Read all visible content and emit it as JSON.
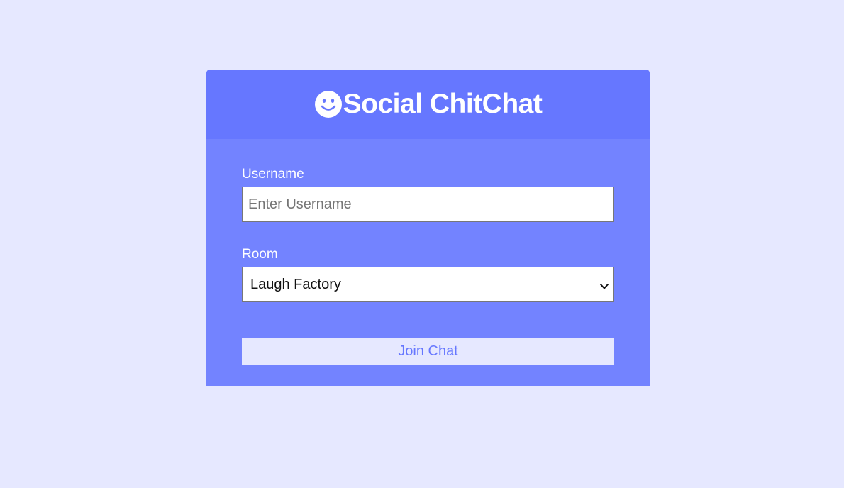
{
  "header": {
    "logo_icon": "smiley-face-icon",
    "title": "Social ChitChat"
  },
  "form": {
    "username": {
      "label": "Username",
      "placeholder": "Enter Username",
      "value": ""
    },
    "room": {
      "label": "Room",
      "selected": "Laugh Factory"
    },
    "submit_label": "Join Chat"
  },
  "colors": {
    "page_background": "#e6e8ff",
    "header_background": "#6677ff",
    "body_background": "#7383ff",
    "button_text": "#6677ff"
  }
}
